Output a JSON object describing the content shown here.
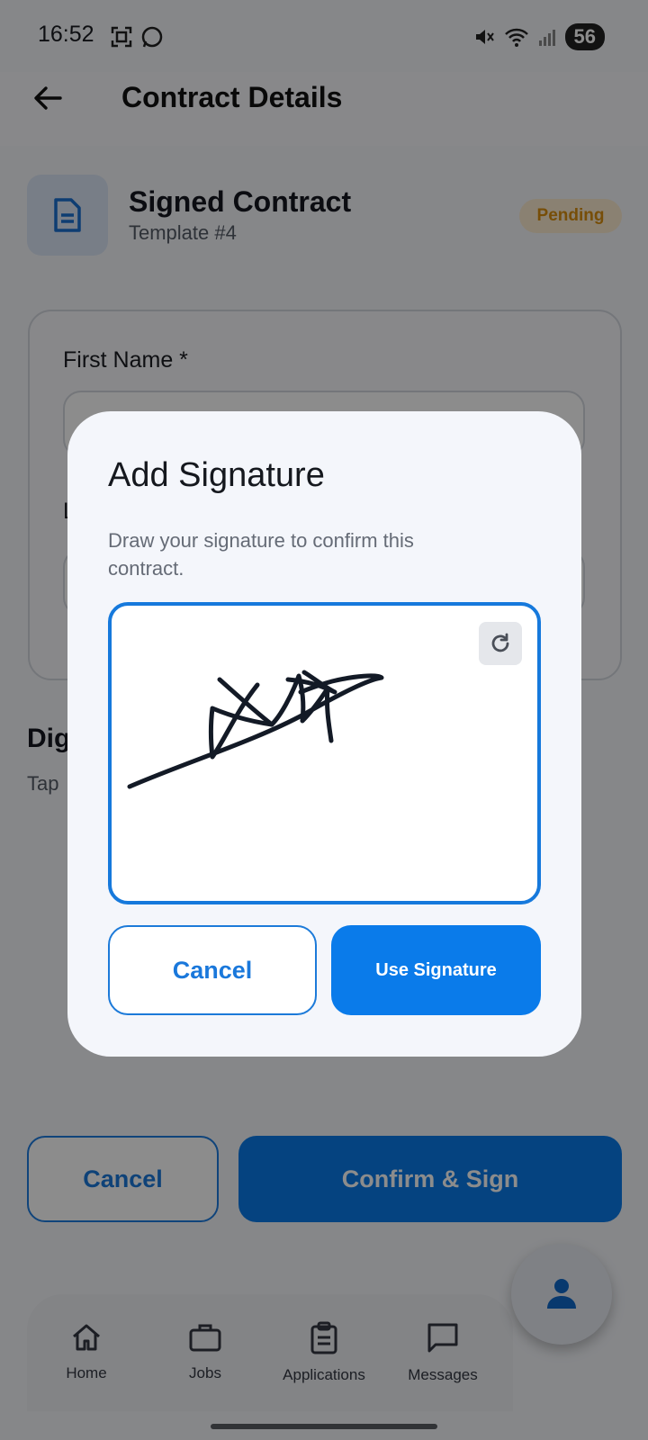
{
  "status_bar": {
    "time": "16:52",
    "battery": "56"
  },
  "header": {
    "title": "Contract Details"
  },
  "contract": {
    "name": "Signed Contract",
    "template": "Template #4",
    "status": "Pending"
  },
  "form": {
    "first_name_label": "First Name *",
    "second_label_fragment": "L"
  },
  "signature_section": {
    "title_fragment": "Dig",
    "hint_fragment": "Tap"
  },
  "actions": {
    "cancel": "Cancel",
    "confirm": "Confirm & Sign"
  },
  "nav": {
    "items": [
      {
        "label": "Home",
        "icon": "home-icon"
      },
      {
        "label": "Jobs",
        "icon": "briefcase-icon"
      },
      {
        "label": "Applications",
        "icon": "clipboard-icon"
      },
      {
        "label": "Messages",
        "icon": "message-icon"
      }
    ]
  },
  "fab": {
    "icon": "profile-icon"
  },
  "dialog": {
    "title": "Add Signature",
    "description": "Draw your signature to confirm this contract.",
    "cancel": "Cancel",
    "use_signature": "Use Signature"
  },
  "colors": {
    "primary": "#0a7bea",
    "pending_text": "#d98e10",
    "pending_bg": "#fbecd0"
  }
}
